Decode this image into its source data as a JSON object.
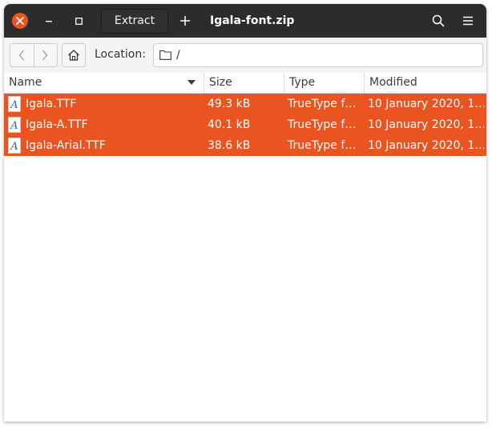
{
  "header": {
    "extract_label": "Extract",
    "title": "Igala-font.zip",
    "icons": [
      "close-icon",
      "minimize-icon",
      "maximize-icon",
      "add-icon",
      "search-icon",
      "menu-icon"
    ],
    "accent": "#e95420"
  },
  "location": {
    "label": "Location:",
    "value": "/"
  },
  "columns": {
    "name": "Name",
    "size": "Size",
    "type": "Type",
    "modified": "Modified"
  },
  "files": [
    {
      "name": "Igala.TTF",
      "size": "49.3 kB",
      "type": "TrueType f…",
      "modified": "10 January 2020, 1…"
    },
    {
      "name": "Igala-A.TTF",
      "size": "40.1 kB",
      "type": "TrueType f…",
      "modified": "10 January 2020, 1…"
    },
    {
      "name": "Igala-Arial.TTF",
      "size": "38.6 kB",
      "type": "TrueType f…",
      "modified": "10 January 2020, 1…"
    }
  ],
  "selection_color": "#e95420"
}
